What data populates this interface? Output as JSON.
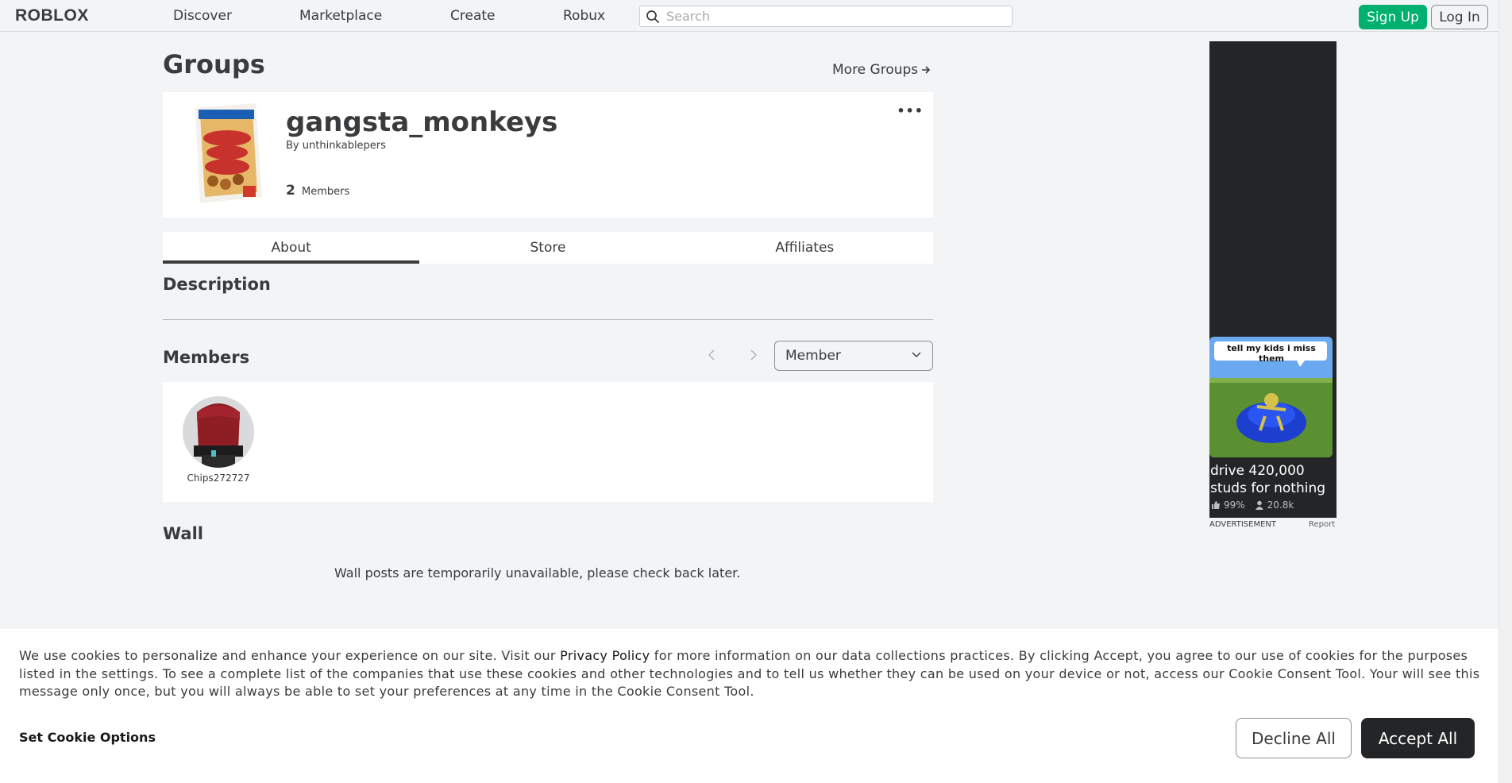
{
  "nav": {
    "logo": "ROBLOX",
    "links": [
      "Discover",
      "Marketplace",
      "Create",
      "Robux"
    ],
    "search_placeholder": "Search",
    "signup_label": "Sign Up",
    "login_label": "Log In"
  },
  "page": {
    "title": "Groups",
    "more_groups": "More Groups"
  },
  "group": {
    "name": "gangsta_monkeys",
    "by_prefix": "By",
    "owner": "unthinkablepers",
    "member_count": "2",
    "members_label": "Members",
    "more_menu": "•••"
  },
  "tabs": [
    {
      "label": "About",
      "active": true
    },
    {
      "label": "Store",
      "active": false
    },
    {
      "label": "Affiliates",
      "active": false
    }
  ],
  "sections": {
    "description": "Description",
    "members": "Members",
    "wall": "Wall"
  },
  "members_panel": {
    "role_filter": "Member",
    "members": [
      {
        "username": "Chips272727"
      }
    ]
  },
  "wall": {
    "message": "Wall posts are temporarily unavailable, please check back later."
  },
  "ad": {
    "caption": "tell my kids i miss them",
    "title": "drive 420,000 studs for nothing",
    "rating": "99%",
    "players": "20.8k",
    "label": "ADVERTISEMENT",
    "report": "Report"
  },
  "cookie": {
    "text_before": "We use cookies to personalize and enhance your experience on our site. Visit our ",
    "privacy_link": "Privacy Policy",
    "text_after": " for more information on our data collections practices. By clicking Accept, you agree to our use of cookies for the purposes listed in the settings. To see a complete list of the companies that use these cookies and other technologies and to tell us whether they can be used on your device or not, access our Cookie Consent Tool. Your will see this message only once, but you will always be able to set your preferences at any time in the Cookie Consent Tool.",
    "options_label": "Set Cookie Options",
    "decline_label": "Decline All",
    "accept_label": "Accept All"
  },
  "colors": {
    "brand_green": "#00b06f",
    "dark": "#232527",
    "text": "#393b3d",
    "background": "#f2f4f5"
  }
}
